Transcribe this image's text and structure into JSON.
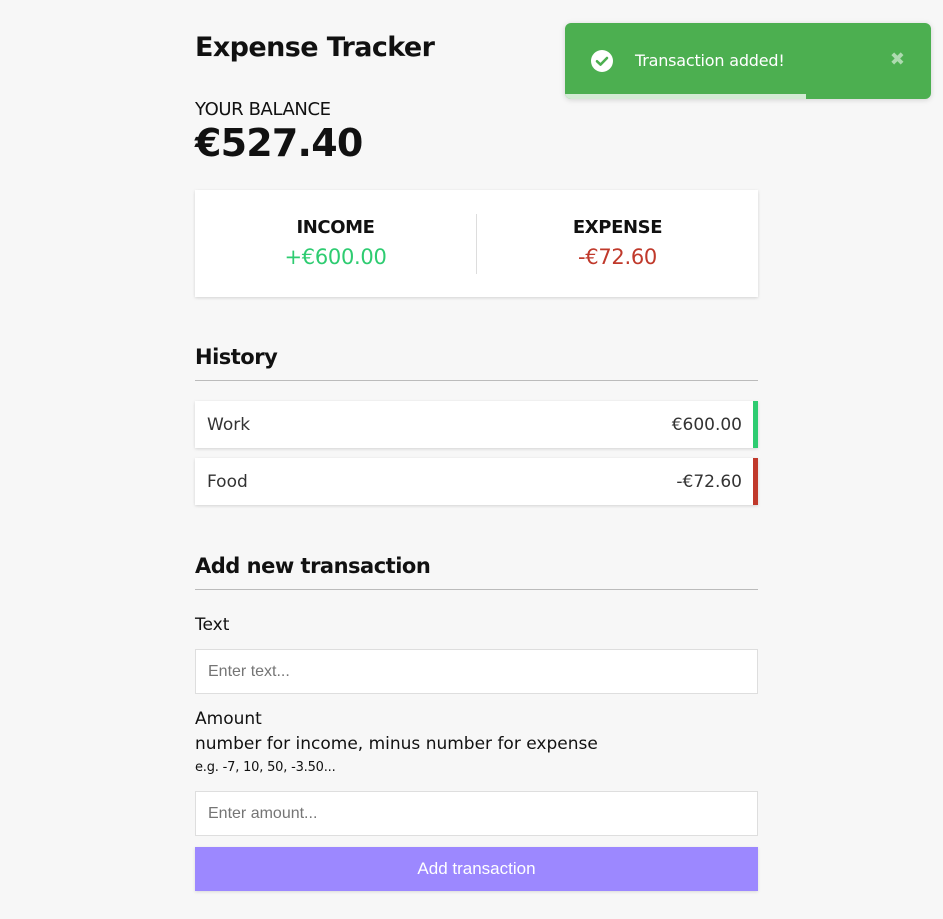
{
  "app": {
    "title": "Expense Tracker"
  },
  "balance": {
    "label": "YOUR BALANCE",
    "value": "€527.40"
  },
  "summary": {
    "income_label": "INCOME",
    "income_value": "+€600.00",
    "expense_label": "EXPENSE",
    "expense_value": "-€72.60"
  },
  "history": {
    "title": "History",
    "items": [
      {
        "text": "Work",
        "amount": "€600.00",
        "type": "income"
      },
      {
        "text": "Food",
        "amount": "-€72.60",
        "type": "expense"
      }
    ]
  },
  "form": {
    "title": "Add new transaction",
    "text_label": "Text",
    "text_placeholder": "Enter text...",
    "amount_label": "Amount",
    "amount_hint": "number for income, minus number for expense",
    "amount_example": "e.g. -7, 10, 50, -3.50...",
    "amount_placeholder": "Enter amount...",
    "submit_label": "Add transaction"
  },
  "toast": {
    "message": "Transaction added!",
    "close_glyph": "✖",
    "icon": "check-circle-icon",
    "progress": 0.658
  },
  "colors": {
    "income": "#2ecc71",
    "expense": "#c0392b",
    "button": "#9c88ff",
    "toast": "#4caf50"
  }
}
